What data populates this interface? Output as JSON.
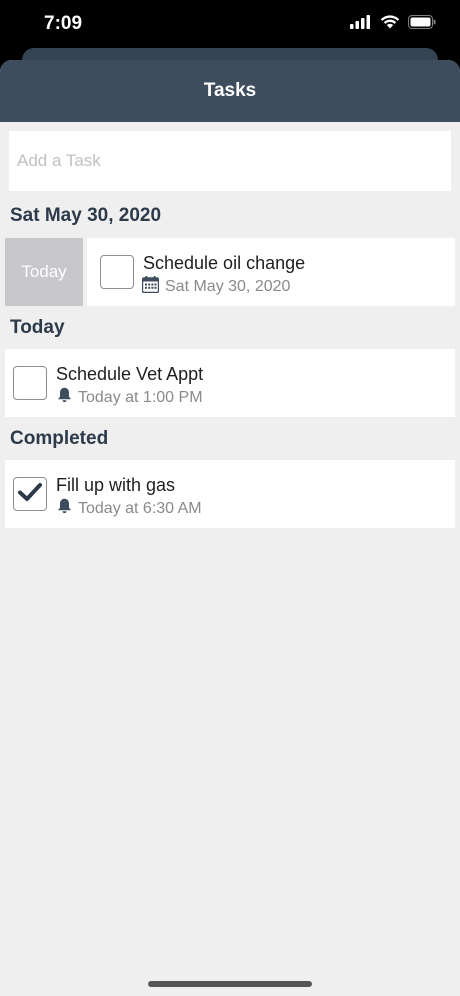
{
  "status_bar": {
    "time": "7:09"
  },
  "nav": {
    "title": "Tasks"
  },
  "add_task": {
    "placeholder": "Add a Task"
  },
  "sections": [
    {
      "header": "Sat May 30, 2020",
      "swipe_action": "Today",
      "task": {
        "title": "Schedule oil change",
        "subtitle": "Sat May 30, 2020",
        "icon": "calendar-icon",
        "checked": false
      }
    },
    {
      "header": "Today",
      "task": {
        "title": "Schedule Vet Appt",
        "subtitle": "Today at 1:00 PM",
        "icon": "bell-icon",
        "checked": false
      }
    },
    {
      "header": "Completed",
      "task": {
        "title": "Fill up with gas",
        "subtitle": "Today at 6:30 AM",
        "icon": "bell-icon",
        "checked": true
      }
    }
  ],
  "colors": {
    "nav_bg": "#3d4d5e",
    "header_text": "#2c3a4a",
    "background": "#efefef",
    "swipe_bg": "#c7c7cc"
  }
}
